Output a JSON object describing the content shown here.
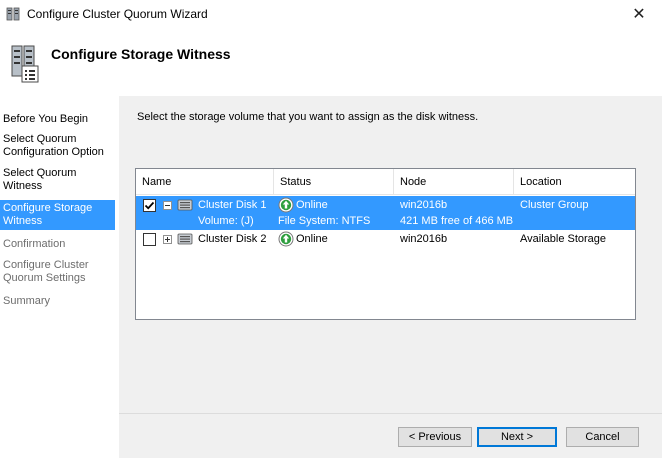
{
  "window": {
    "title": "Configure Cluster Quorum Wizard",
    "close_glyph": "✕"
  },
  "header": {
    "title": "Configure Storage Witness"
  },
  "steps": [
    {
      "label": "Before You Begin",
      "state": "normal"
    },
    {
      "label": "Select Quorum Configuration Option",
      "state": "normal"
    },
    {
      "label": "Select Quorum Witness",
      "state": "normal"
    },
    {
      "label": "Configure Storage Witness",
      "state": "active"
    },
    {
      "label": "Confirmation",
      "state": "disabled"
    },
    {
      "label": "Configure Cluster Quorum Settings",
      "state": "disabled"
    },
    {
      "label": "Summary",
      "state": "disabled"
    }
  ],
  "main": {
    "instruction": "Select the storage volume that you want to assign as the disk witness.",
    "columns": [
      "Name",
      "Status",
      "Node",
      "Location"
    ],
    "rows": [
      {
        "checked": true,
        "expanded": true,
        "name": "Cluster Disk 1",
        "status": "Online",
        "node": "win2016b",
        "location": "Cluster Group",
        "detail": {
          "name": "Volume: (J)",
          "status": "File System: NTFS",
          "node": "421 MB free of 466 MB"
        }
      },
      {
        "checked": false,
        "expanded": false,
        "name": "Cluster Disk 2",
        "status": "Online",
        "node": "win2016b",
        "location": "Available Storage"
      }
    ]
  },
  "buttons": {
    "previous": "< Previous",
    "next": "Next >",
    "cancel": "Cancel"
  },
  "colors": {
    "selection": "#3399ff",
    "online_green": "#2e9e3e"
  }
}
